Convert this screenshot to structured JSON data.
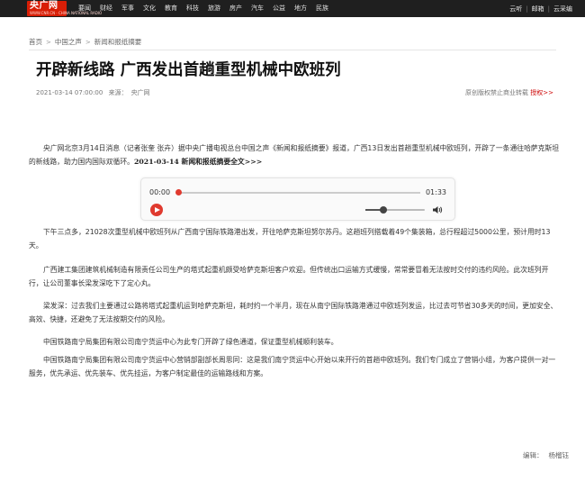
{
  "header": {
    "logo_text": "央广网",
    "logo_subtext": "WWW.CNR.CN · CHINA NATIONAL RADIO",
    "nav": [
      "要闻",
      "财经",
      "军事",
      "文化",
      "教育",
      "科技",
      "旅游",
      "房产",
      "汽车",
      "公益",
      "地方",
      "民族"
    ],
    "right_links": [
      "云听",
      "邮箱",
      "云采编"
    ]
  },
  "breadcrumb": [
    "首页",
    "中国之声",
    "新闻和报纸摘要"
  ],
  "article": {
    "title": "开辟新线路 广西发出首趟重型机械中欧班列",
    "date": "2021-03-14 07:00:00",
    "source_label": "来源：",
    "source": "央广网",
    "copyright_text": "原创版权禁止商业转载",
    "copyright_link": "授权>>",
    "p1": "央广网北京3月14日消息（记者张奎 张卉）据中央广播电视总台中国之声《新闻和报纸摘要》报道，广西13日发出首趟重型机械中欧班列，开辟了一条通往哈萨克斯坦的新线路，助力国内国际双循环。",
    "p1_link": "2021-03-14 新闻和报纸摘要全文>>>",
    "p2": "下午三点多，21028次重型机械中欧班列从广西南宁国际铁路港出发，开往哈萨克斯坦努尔苏丹。这趟班列搭载着49个集装箱，总行程超过5000公里，预计用时13天。",
    "p3": "广西建工集团建筑机械制造有限责任公司生产的塔式起重机颇受哈萨克斯坦客户欢迎。但传统出口运输方式缓慢，常常要冒着无法按时交付的违约风险。此次班列开行，让公司董事长梁发深吃下了定心丸。",
    "p4": "梁发深：过去我们主要通过公路将塔式起重机运到哈萨克斯坦，耗时约一个半月，现在从南宁国际铁路港通过中欧班列发运，比过去可节省30多天的时间，更加安全、高效、快捷，还避免了无法按期交付的风险。",
    "p5": "中国铁路南宁局集团有限公司南宁货运中心为此专门开辟了绿色通道，保证重型机械顺利装车。",
    "p6": "中国铁路南宁局集团有限公司南宁货运中心营销部副部长周思同：这是我们南宁货运中心开始以来开行的首趟中欧班列。我们专门成立了营销小组，为客户提供一对一服务，优先承运、优先装车、优先挂运，为客户制定最佳的运输路线和方案。",
    "editor_label": "编辑：",
    "editor": "杨榴钰"
  },
  "player": {
    "current_time": "00:00",
    "duration": "01:33",
    "progress": 0.0,
    "volume": 0.3,
    "play_icon": "play-icon",
    "volume_icon": "speaker-icon",
    "accent": "#e03a2f"
  }
}
